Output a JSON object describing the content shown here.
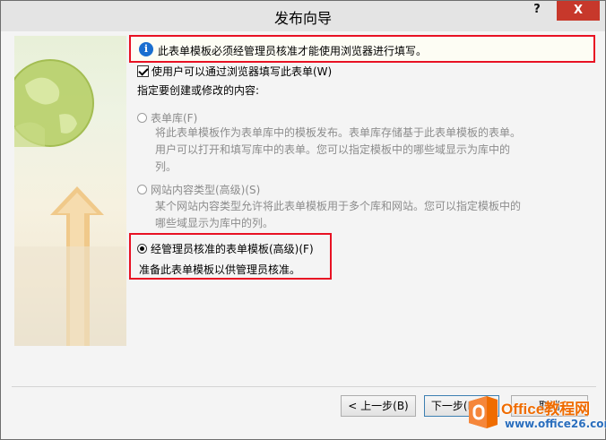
{
  "window": {
    "title": "发布向导",
    "help_label": "?",
    "close_label": "X"
  },
  "notice": {
    "icon": "info-icon",
    "icon_glyph": "i",
    "text": "此表单模板必须经管理员核准才能使用浏览器进行填写。"
  },
  "browser_checkbox": {
    "label": "使用户可以通过浏览器填写此表单(W)",
    "checked": true
  },
  "section_label": "指定要创建或修改的内容:",
  "options": [
    {
      "label": "表单库(F)",
      "selected": false,
      "enabled": false,
      "description": "将此表单模板作为表单库中的模板发布。表单库存储基于此表单模板的表单。用户可以打开和填写库中的表单。您可以指定模板中的哪些域显示为库中的列。"
    },
    {
      "label": "网站内容类型(高级)(S)",
      "selected": false,
      "enabled": false,
      "description": "某个网站内容类型允许将此表单模板用于多个库和网站。您可以指定模板中的哪些域显示为库中的列。"
    },
    {
      "label": "经管理员核准的表单模板(高级)(F)",
      "selected": true,
      "enabled": true,
      "description": "准备此表单模板以供管理员核准。"
    }
  ],
  "buttons": {
    "back": "< 上一步(B)",
    "next": "下一步(N) >",
    "cancel": "取消"
  },
  "watermark": {
    "brand": "Office教程网",
    "url": "www.office26.com"
  },
  "colors": {
    "highlight_border": "#e81123",
    "close_button": "#c7382b",
    "info_icon": "#1a6fd0",
    "watermark_orange": "#ef6c00",
    "watermark_blue": "#2a6ebd"
  }
}
